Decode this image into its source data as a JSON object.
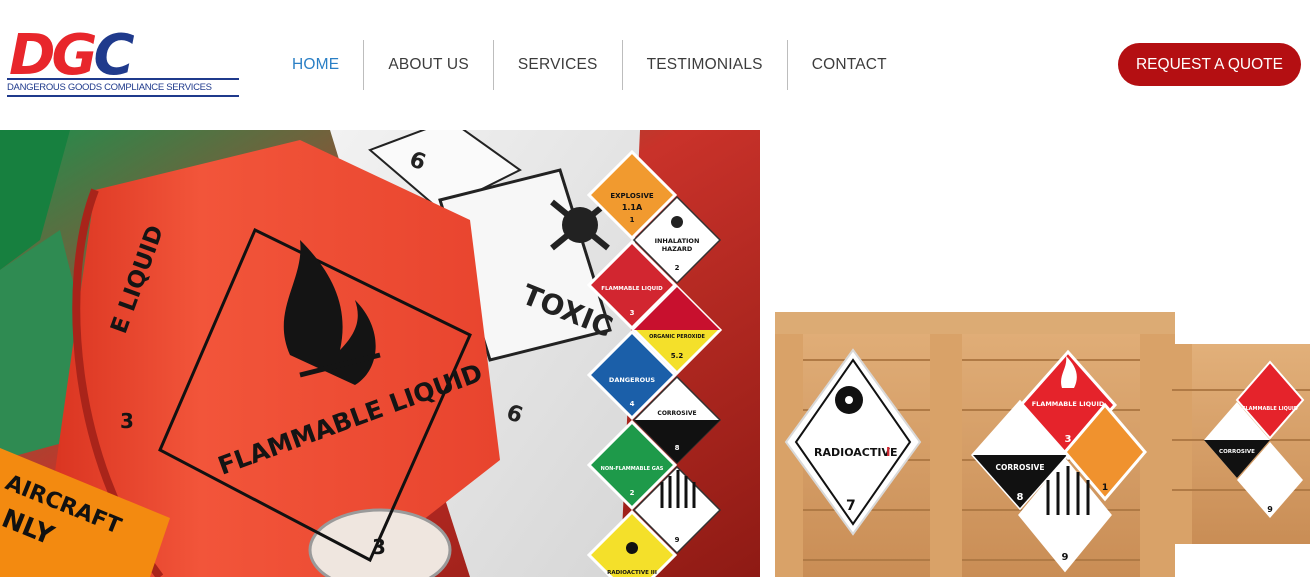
{
  "brand": {
    "logo_text": "DGC",
    "tagline": "DANGEROUS GOODS COMPLIANCE SERVICES"
  },
  "nav": {
    "items": [
      {
        "label": "HOME",
        "active": true
      },
      {
        "label": "ABOUT US",
        "active": false
      },
      {
        "label": "SERVICES",
        "active": false
      },
      {
        "label": "TESTIMONIALS",
        "active": false
      },
      {
        "label": "CONTACT",
        "active": false
      }
    ],
    "cta_label": "REQUEST A QUOTE"
  },
  "hero": {
    "labels": {
      "flammable_roll": "FLAMMABLE LIQUID",
      "flammable_roll_top": "E LIQUID",
      "class_3": "3",
      "toxic": "TOXIC",
      "class_6": "6",
      "aircraft": "AIRCRAFT",
      "only": "NLY",
      "explosive": "EXPLOSIVE",
      "explosive_div": "1.1A",
      "explosive_class": "1",
      "inhalation": "INHALATION",
      "hazard": "HAZARD",
      "class_2": "2",
      "flammable_liquid_small": "FLAMMABLE LIQUID",
      "organic_peroxide": "ORGANIC PEROXIDE",
      "class_5_2": "5.2",
      "dangerous": "DANGEROUS",
      "class_4": "4",
      "corrosive": "CORROSIVE",
      "class_8": "8",
      "non_flammable_gas": "NON-FLAMMABLE GAS",
      "class_9": "9",
      "radioactive_small": "RADIOACTIVE III",
      "radioactive": "RADIOACTIVE",
      "radioactive_roman": "I",
      "class_7": "7",
      "crate_flammable": "FLAMMABLE LIQUID",
      "crate_corrosive": "CORROSIVE"
    }
  },
  "colors": {
    "accent_blue": "#2a7fc5",
    "cta_red": "#b40f12",
    "nav_text": "#3c3c3c",
    "logo_red": "#e8262b",
    "logo_blue": "#1f3a8c"
  }
}
